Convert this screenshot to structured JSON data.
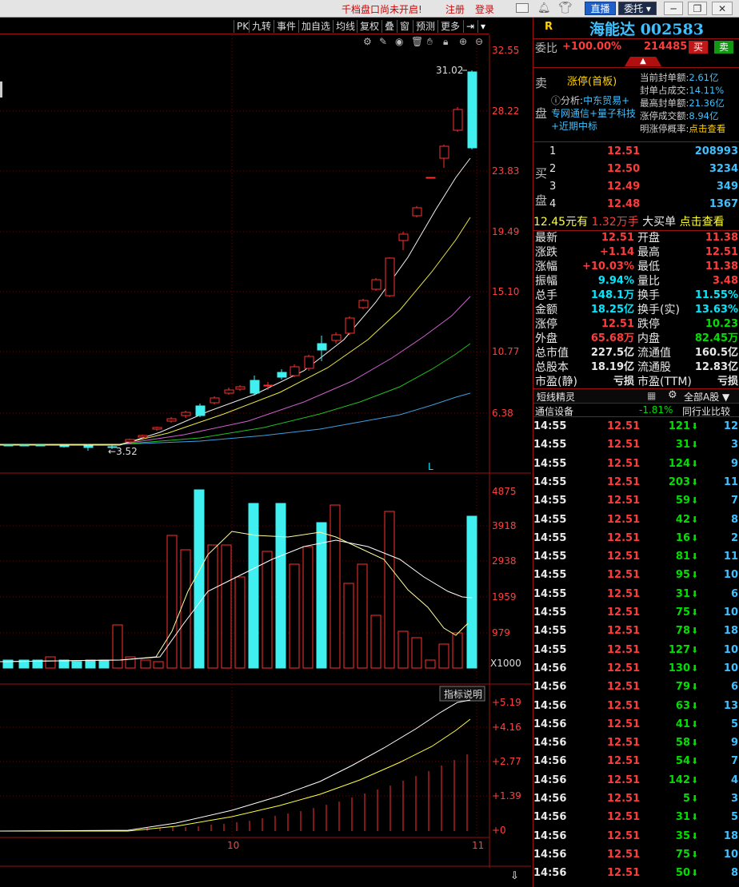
{
  "topbar": {
    "notice": "千档盘口尚未开启!",
    "register": "注册",
    "login": "登录",
    "live": "直播",
    "entrust": "委托"
  },
  "toolbar": {
    "items": [
      "PK",
      "九转",
      "事件",
      "加自选",
      "均线",
      "复权",
      "叠",
      "窗",
      "预测",
      "更多"
    ]
  },
  "main_chart": {
    "price_ticks": [
      "32.55",
      "28.22",
      "23.83",
      "19.49",
      "15.10",
      "10.77",
      "6.38"
    ],
    "high_label": "31.02",
    "low_label": "3.52",
    "marker": "L",
    "colors": {
      "rise": "#ff3030",
      "fall": "#40f0f0"
    }
  },
  "volume_chart": {
    "ticks": [
      "4875",
      "3918",
      "2938",
      "1959",
      "979"
    ],
    "unit": "X1000"
  },
  "indicator_chart": {
    "button": "指标说明",
    "ticks": [
      "+5.19",
      "+4.16",
      "+2.77",
      "+1.39",
      "+0"
    ],
    "x_labels": [
      "10",
      "11"
    ]
  },
  "stock": {
    "marker": "R",
    "name": "海能达",
    "code": "002583",
    "weibi_label": "委比",
    "weibi": "+100.00%",
    "weicha": "214485",
    "buy": "买",
    "sell": "卖"
  },
  "limit_panel": {
    "side_label_1": "卖",
    "side_label_2": "盘",
    "status": "涨停(首板)",
    "analysis_label": "分析:",
    "tags": [
      "中东贸易+",
      "专网通信+量子科技",
      "+近期中标"
    ],
    "stats": [
      {
        "label": "当前封单额:",
        "value": "2.61亿"
      },
      {
        "label": "封单占成交:",
        "value": "14.11%"
      },
      {
        "label": "最高封单额:",
        "value": "21.36亿"
      },
      {
        "label": "涨停成交额:",
        "value": "8.94亿"
      },
      {
        "label": "明涨停概率:",
        "value": "点击查看"
      }
    ]
  },
  "order_book": {
    "side_label_1": "买",
    "side_label_2": "盘",
    "bids": [
      {
        "level": "1",
        "price": "12.51",
        "volume": "208993"
      },
      {
        "level": "2",
        "price": "12.50",
        "volume": "3234"
      },
      {
        "level": "3",
        "price": "12.49",
        "volume": "349"
      },
      {
        "level": "4",
        "price": "12.48",
        "volume": "1367"
      }
    ]
  },
  "big_order": {
    "price": "12.45元有",
    "amount": "1.32万手",
    "label": "大买单",
    "link": "点击查看"
  },
  "quote": [
    [
      "最新",
      "12.51",
      "red",
      "开盘",
      "11.38",
      "red"
    ],
    [
      "涨跌",
      "+1.14",
      "red",
      "最高",
      "12.51",
      "red"
    ],
    [
      "涨幅",
      "+10.03%",
      "red",
      "最低",
      "11.38",
      "red"
    ],
    [
      "振幅",
      "9.94%",
      "cyan",
      "量比",
      "3.48",
      "red"
    ],
    [
      "总手",
      "148.1万",
      "cyan",
      "换手",
      "11.55%",
      "cyan"
    ],
    [
      "金额",
      "18.25亿",
      "cyan",
      "换手(实)",
      "13.63%",
      "cyan"
    ],
    [
      "涨停",
      "12.51",
      "red",
      "跌停",
      "10.23",
      "grn"
    ],
    [
      "外盘",
      "65.68万",
      "red",
      "内盘",
      "82.45万",
      "grn"
    ],
    [
      "总市值",
      "227.5亿",
      "wht",
      "流通值",
      "160.5亿",
      "wht"
    ],
    [
      "总股本",
      "18.19亿",
      "wht",
      "流通股",
      "12.83亿",
      "wht"
    ],
    [
      "市盈(静)",
      "亏损",
      "wht",
      "市盈(TTM)",
      "亏损",
      "wht"
    ]
  ],
  "tabs": {
    "sprite": "短线精灵",
    "market": "全部A股",
    "industry": "通信设备",
    "industry_change": "-1.81%",
    "compare": "同行业比较"
  },
  "ticks": [
    [
      "14:55",
      "12.51",
      "121",
      "12"
    ],
    [
      "14:55",
      "12.51",
      "31",
      "3"
    ],
    [
      "14:55",
      "12.51",
      "124",
      "9"
    ],
    [
      "14:55",
      "12.51",
      "203",
      "11"
    ],
    [
      "14:55",
      "12.51",
      "59",
      "7"
    ],
    [
      "14:55",
      "12.51",
      "42",
      "8"
    ],
    [
      "14:55",
      "12.51",
      "16",
      "2"
    ],
    [
      "14:55",
      "12.51",
      "81",
      "11"
    ],
    [
      "14:55",
      "12.51",
      "95",
      "10"
    ],
    [
      "14:55",
      "12.51",
      "31",
      "6"
    ],
    [
      "14:55",
      "12.51",
      "75",
      "10"
    ],
    [
      "14:55",
      "12.51",
      "78",
      "18"
    ],
    [
      "14:55",
      "12.51",
      "127",
      "10"
    ],
    [
      "14:56",
      "12.51",
      "130",
      "10"
    ],
    [
      "14:56",
      "12.51",
      "79",
      "6"
    ],
    [
      "14:56",
      "12.51",
      "63",
      "13"
    ],
    [
      "14:56",
      "12.51",
      "41",
      "5"
    ],
    [
      "14:56",
      "12.51",
      "58",
      "9"
    ],
    [
      "14:56",
      "12.51",
      "54",
      "7"
    ],
    [
      "14:56",
      "12.51",
      "142",
      "4"
    ],
    [
      "14:56",
      "12.51",
      "5",
      "3"
    ],
    [
      "14:56",
      "12.51",
      "31",
      "5"
    ],
    [
      "14:56",
      "12.51",
      "35",
      "18"
    ],
    [
      "14:56",
      "12.51",
      "75",
      "10"
    ],
    [
      "14:56",
      "12.51",
      "50",
      "8"
    ]
  ]
}
